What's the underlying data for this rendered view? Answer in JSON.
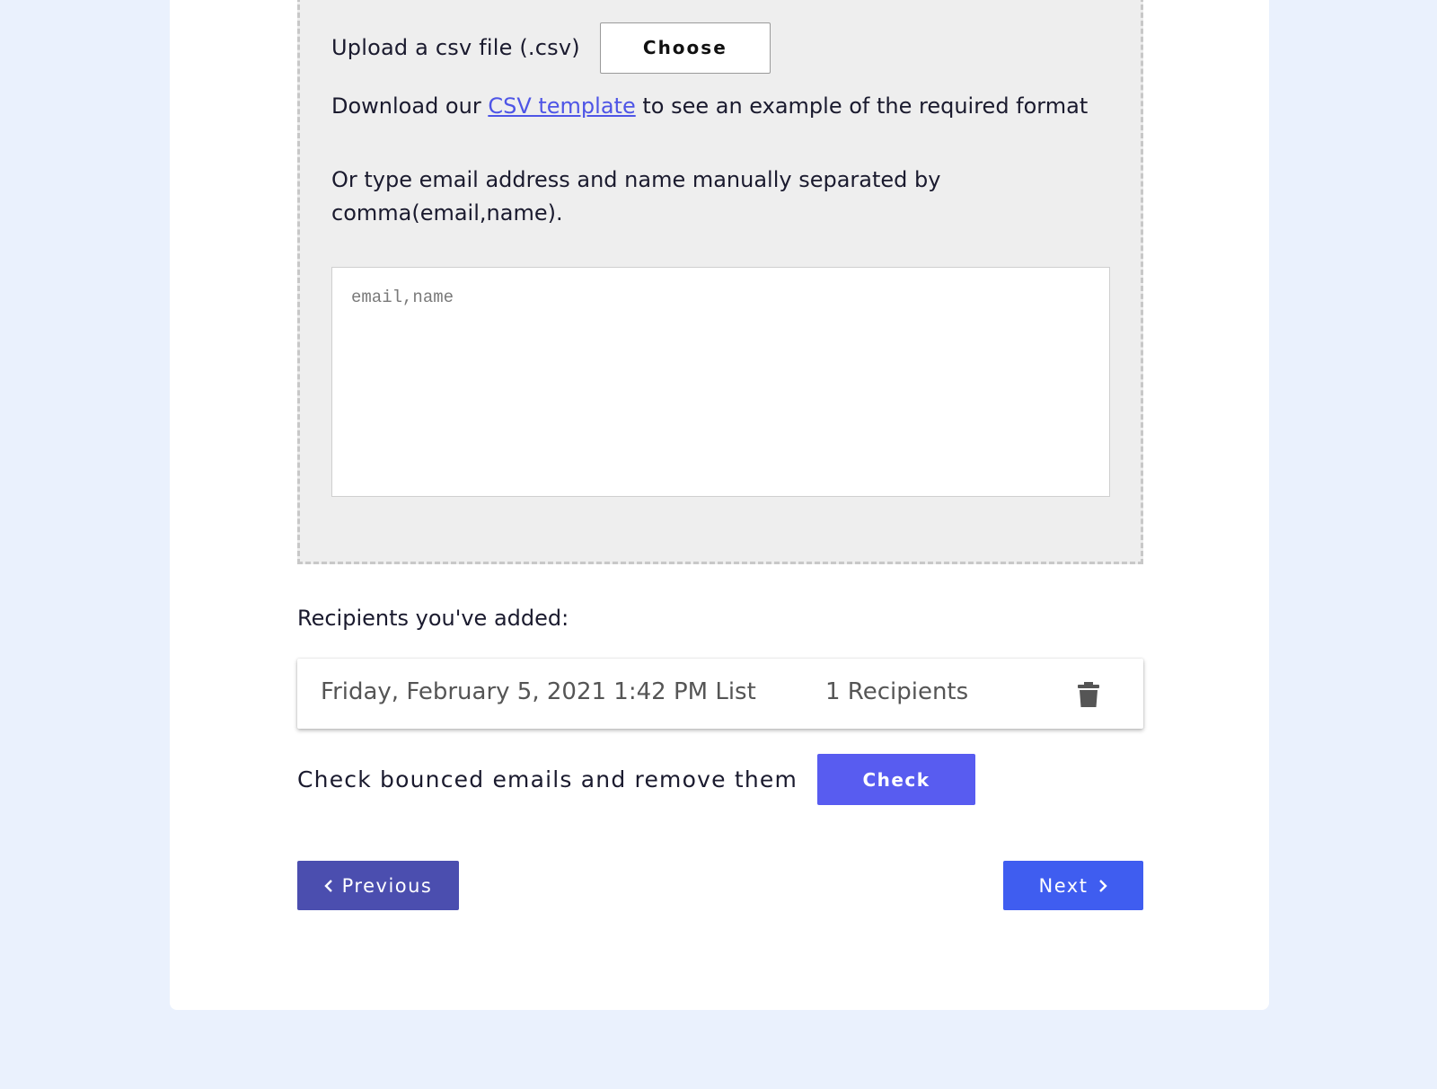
{
  "upload": {
    "label": "Upload a csv file (.csv)",
    "choose_label": "Choose"
  },
  "download": {
    "prefix": "Download our ",
    "link_text": "CSV template",
    "suffix": " to see an example of the required format"
  },
  "manual": {
    "instructions": "Or type email address and name manually separated by comma(email,name).",
    "placeholder": "email,name",
    "value": ""
  },
  "recipients": {
    "title": "Recipients you've added:",
    "items": [
      {
        "list_name": "Friday, February 5, 2021 1:42 PM List",
        "count_text": "1 Recipients",
        "delete_icon": "trash-icon"
      }
    ]
  },
  "bounce": {
    "label": "Check bounced emails and remove them",
    "check_label": "Check"
  },
  "nav": {
    "previous_label": "Previous",
    "next_label": "Next"
  },
  "colors": {
    "page_background": "#eaf1fd",
    "dropzone_background": "#eeeeee",
    "link": "#4e55e6",
    "check_button": "#585cf0",
    "previous_button": "#4b4eaf",
    "next_button": "#3f5df0"
  }
}
